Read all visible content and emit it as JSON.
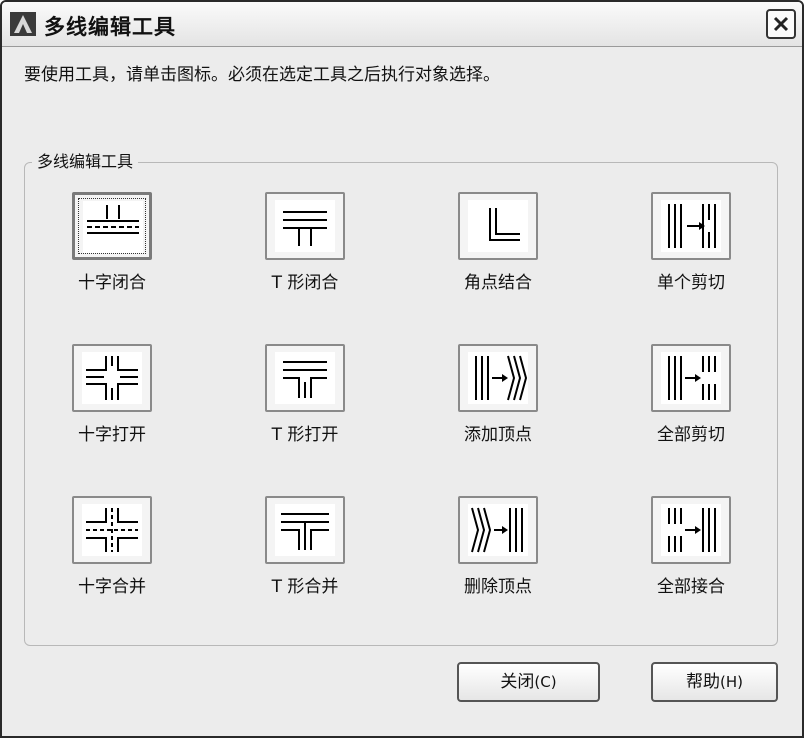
{
  "window": {
    "title": "多线编辑工具",
    "close_icon": "close-icon"
  },
  "instruction": "要使用工具，请单击图标。必须在选定工具之后执行对象选择。",
  "group": {
    "label": "多线编辑工具"
  },
  "tools": [
    {
      "label": "十字闭合",
      "icon": "closed-cross-icon",
      "selected": true
    },
    {
      "label": "T 形闭合",
      "icon": "closed-tee-icon",
      "selected": false
    },
    {
      "label": "角点结合",
      "icon": "corner-joint-icon",
      "selected": false
    },
    {
      "label": "单个剪切",
      "icon": "cut-single-icon",
      "selected": false
    },
    {
      "label": "十字打开",
      "icon": "open-cross-icon",
      "selected": false
    },
    {
      "label": "T 形打开",
      "icon": "open-tee-icon",
      "selected": false
    },
    {
      "label": "添加顶点",
      "icon": "add-vertex-icon",
      "selected": false
    },
    {
      "label": "全部剪切",
      "icon": "cut-all-icon",
      "selected": false
    },
    {
      "label": "十字合并",
      "icon": "merged-cross-icon",
      "selected": false
    },
    {
      "label": "T 形合并",
      "icon": "merged-tee-icon",
      "selected": false
    },
    {
      "label": "删除顶点",
      "icon": "delete-vertex-icon",
      "selected": false
    },
    {
      "label": "全部接合",
      "icon": "weld-all-icon",
      "selected": false
    }
  ],
  "buttons": {
    "close_label": "关闭",
    "close_hotkey": "(C)",
    "help_label": "帮助",
    "help_hotkey": "(H)"
  }
}
